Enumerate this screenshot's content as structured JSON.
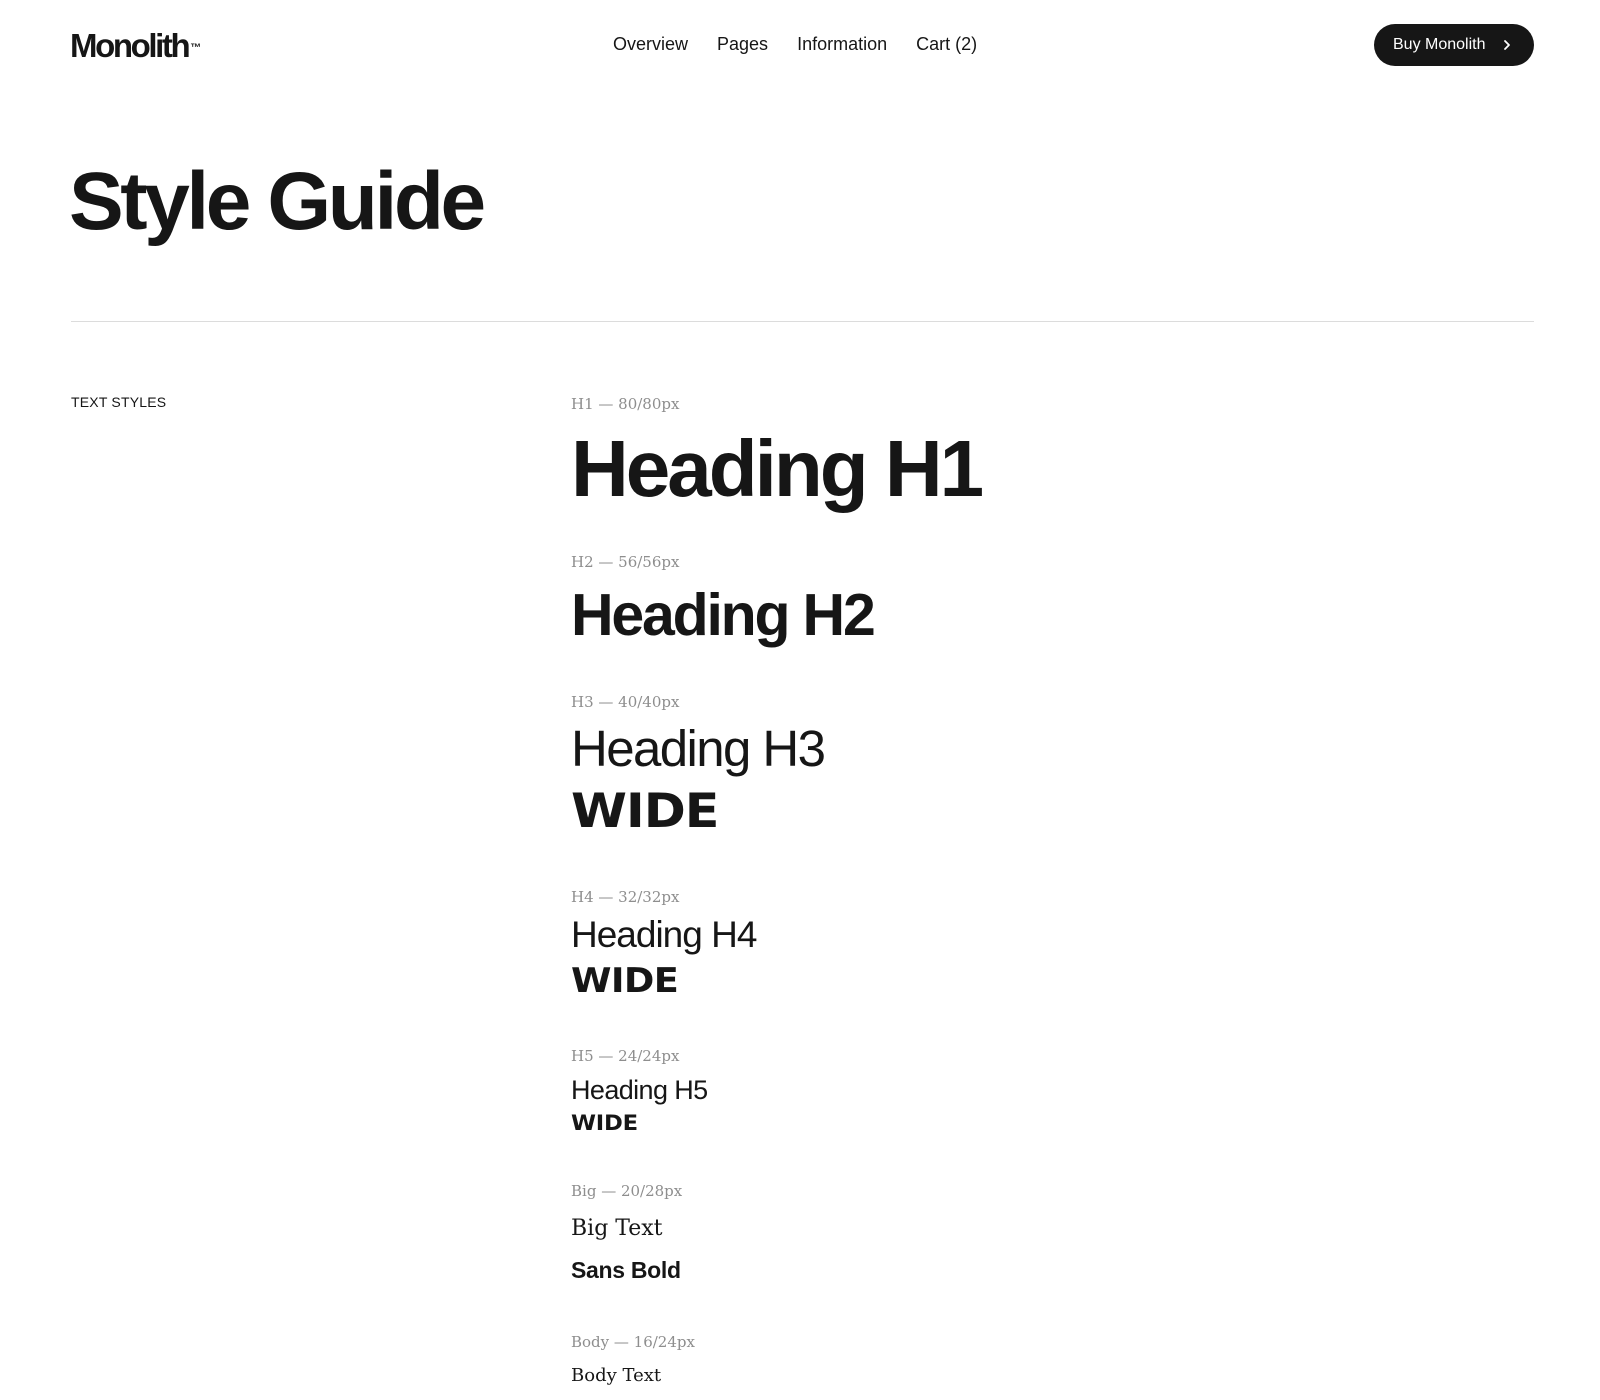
{
  "header": {
    "logo": "Monolith",
    "logo_mark": "™",
    "nav": [
      {
        "label": "Overview"
      },
      {
        "label": "Pages"
      },
      {
        "label": "Information"
      },
      {
        "label": "Cart (2)"
      }
    ],
    "buy_button": {
      "label": "Buy Monolith",
      "icon": "chevron-right-icon"
    }
  },
  "page": {
    "title": "Style Guide"
  },
  "text_styles": {
    "section_label": "TEXT STYLES",
    "items": [
      {
        "spec": "H1 — 80/80px",
        "sample": "Heading H1"
      },
      {
        "spec": "H2 — 56/56px",
        "sample": "Heading H2"
      },
      {
        "spec": "H3 — 40/40px",
        "sample": "Heading H3",
        "wide": "WIDE"
      },
      {
        "spec": "H4 — 32/32px",
        "sample": "Heading H4",
        "wide": "WIDE"
      },
      {
        "spec": "H5 — 24/24px",
        "sample": "Heading H5",
        "wide": "WIDE"
      },
      {
        "spec": "Big — 20/28px",
        "sample": "Big Text",
        "second_sample": "Sans Bold"
      },
      {
        "spec": "Body — 16/24px",
        "sample": "Body Text"
      }
    ]
  },
  "colors": {
    "text": "#161616",
    "spec_text": "#8e8e8e",
    "button_bg": "#161616",
    "button_text": "#ffffff",
    "divider": "#dcdcdc",
    "background": "#ffffff"
  }
}
